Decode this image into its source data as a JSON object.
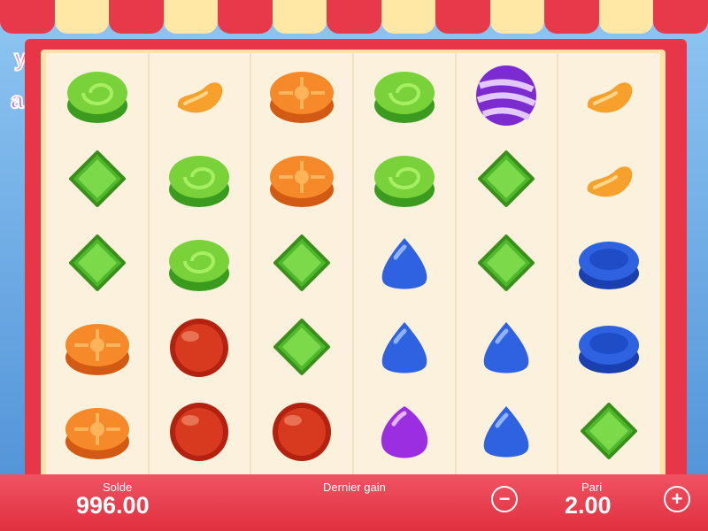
{
  "footer": {
    "balance_label": "Solde",
    "balance_value": "996.00",
    "last_win_label": "Dernier gain",
    "last_win_value": "",
    "bet_label": "Pari",
    "bet_value": "2.00",
    "decrease_bet": "−",
    "increase_bet": "+"
  },
  "reels": [
    [
      "green-swirl",
      "orange-bean",
      "orange-flower",
      "green-swirl",
      "purple-striped",
      "orange-bean"
    ],
    [
      "green-gem",
      "green-swirl",
      "orange-flower",
      "green-swirl",
      "green-gem",
      "orange-bean"
    ],
    [
      "green-gem",
      "green-swirl",
      "green-gem",
      "blue-drop",
      "green-gem",
      "blue-disc"
    ],
    [
      "orange-flower",
      "red-ball",
      "green-gem",
      "blue-drop",
      "blue-drop",
      "blue-disc"
    ],
    [
      "orange-flower",
      "red-ball",
      "red-ball",
      "purple-drop",
      "blue-drop",
      "green-gem"
    ]
  ]
}
